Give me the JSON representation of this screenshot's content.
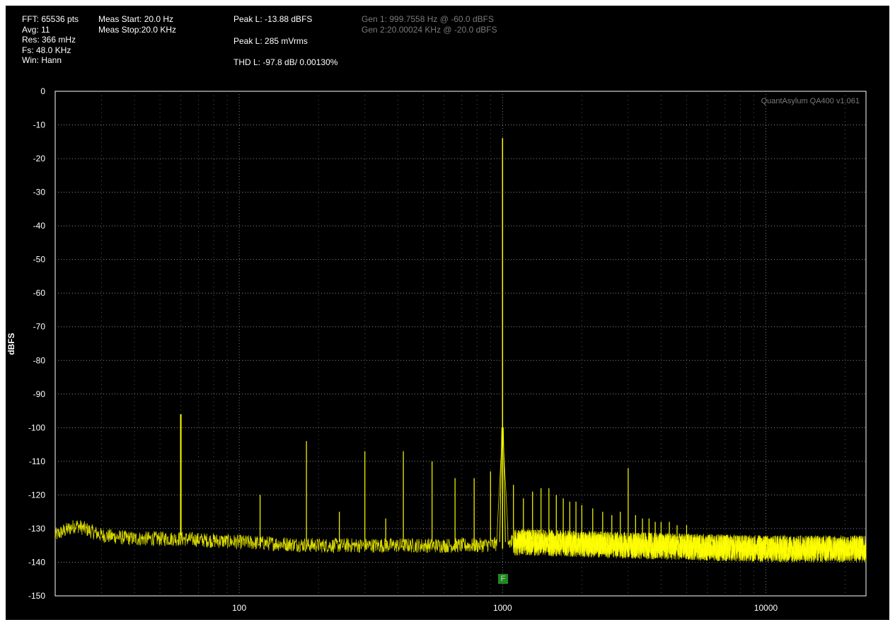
{
  "header": {
    "col1": [
      "FFT: 65536 pts",
      "Avg: 11",
      "Res: 366 mHz",
      "Fs: 48.0 KHz",
      "Win: Hann"
    ],
    "col2": [
      "Meas Start: 20.0 Hz",
      "Meas Stop:20.0 KHz"
    ],
    "col3": {
      "peak_dbfs": "Peak L: -13.88 dBFS",
      "peak_vrms": "Peak L: 285 mVrms",
      "thd": "THD L: -97.8 dB/ 0.00130%"
    },
    "col4": [
      "Gen 1: 999.7558 Hz @ -60.0  dBFS",
      "Gen 2:20.00024 KHz @ -20.0  dBFS"
    ]
  },
  "watermark": "QuantAsylum QA400 v1.061",
  "marker_label": "F",
  "colors": {
    "background": "#000000",
    "trace": "#ffff00",
    "grid": "#8c8c8c",
    "frame": "#ffffff",
    "text": "#ffffff",
    "dim_text": "#7a7a7a",
    "marker": "#1f8a1f"
  },
  "chart_data": {
    "type": "line",
    "title": "",
    "xlabel": "",
    "ylabel": "dBFS",
    "x_scale": "log",
    "xlim": [
      20,
      24000
    ],
    "ylim": [
      -150,
      0
    ],
    "grid": true,
    "x_ticks": [
      {
        "value": 100,
        "label": "100"
      },
      {
        "value": 1000,
        "label": "1000"
      },
      {
        "value": 10000,
        "label": "10000"
      }
    ],
    "y_ticks": [
      {
        "value": 0,
        "label": "0"
      },
      {
        "value": -10,
        "label": "-10"
      },
      {
        "value": -20,
        "label": "-20"
      },
      {
        "value": -30,
        "label": "-30"
      },
      {
        "value": -40,
        "label": "-40"
      },
      {
        "value": -50,
        "label": "-50"
      },
      {
        "value": -60,
        "label": "-60"
      },
      {
        "value": -70,
        "label": "-70"
      },
      {
        "value": -80,
        "label": "-80"
      },
      {
        "value": -90,
        "label": "-90"
      },
      {
        "value": -100,
        "label": "-100"
      },
      {
        "value": -110,
        "label": "-110"
      },
      {
        "value": -120,
        "label": "-120"
      },
      {
        "value": -130,
        "label": "-130"
      },
      {
        "value": -140,
        "label": "-140"
      },
      {
        "value": -150,
        "label": "-150"
      }
    ],
    "noise_floor": [
      {
        "x": 20,
        "y": -132
      },
      {
        "x": 24,
        "y": -129
      },
      {
        "x": 30,
        "y": -132
      },
      {
        "x": 40,
        "y": -133
      },
      {
        "x": 60,
        "y": -133
      },
      {
        "x": 100,
        "y": -134
      },
      {
        "x": 200,
        "y": -135
      },
      {
        "x": 400,
        "y": -135
      },
      {
        "x": 800,
        "y": -135
      },
      {
        "x": 1200,
        "y": -134
      },
      {
        "x": 3000,
        "y": -135
      },
      {
        "x": 10000,
        "y": -136
      },
      {
        "x": 24000,
        "y": -136
      }
    ],
    "fundamental": {
      "x": 1000,
      "y": -13.9
    },
    "spurs": [
      {
        "x": 60,
        "y": -96
      },
      {
        "x": 120,
        "y": -120
      },
      {
        "x": 180,
        "y": -104
      },
      {
        "x": 240,
        "y": -125
      },
      {
        "x": 300,
        "y": -107
      },
      {
        "x": 360,
        "y": -127
      },
      {
        "x": 420,
        "y": -107
      },
      {
        "x": 540,
        "y": -110
      },
      {
        "x": 660,
        "y": -115
      },
      {
        "x": 780,
        "y": -115
      },
      {
        "x": 900,
        "y": -113
      },
      {
        "x": 1100,
        "y": -117
      },
      {
        "x": 1200,
        "y": -121
      },
      {
        "x": 1300,
        "y": -119
      },
      {
        "x": 1400,
        "y": -118
      },
      {
        "x": 1500,
        "y": -118
      },
      {
        "x": 1600,
        "y": -120
      },
      {
        "x": 1700,
        "y": -121
      },
      {
        "x": 1800,
        "y": -122
      },
      {
        "x": 1900,
        "y": -122
      },
      {
        "x": 2000,
        "y": -123
      },
      {
        "x": 2200,
        "y": -124
      },
      {
        "x": 2400,
        "y": -125
      },
      {
        "x": 2600,
        "y": -126
      },
      {
        "x": 2800,
        "y": -125
      },
      {
        "x": 3000,
        "y": -112
      },
      {
        "x": 3200,
        "y": -126
      },
      {
        "x": 3400,
        "y": -127
      },
      {
        "x": 3600,
        "y": -127
      },
      {
        "x": 3800,
        "y": -128
      },
      {
        "x": 4000,
        "y": -128
      },
      {
        "x": 4300,
        "y": -128
      },
      {
        "x": 4600,
        "y": -129
      },
      {
        "x": 5000,
        "y": -129
      }
    ]
  }
}
